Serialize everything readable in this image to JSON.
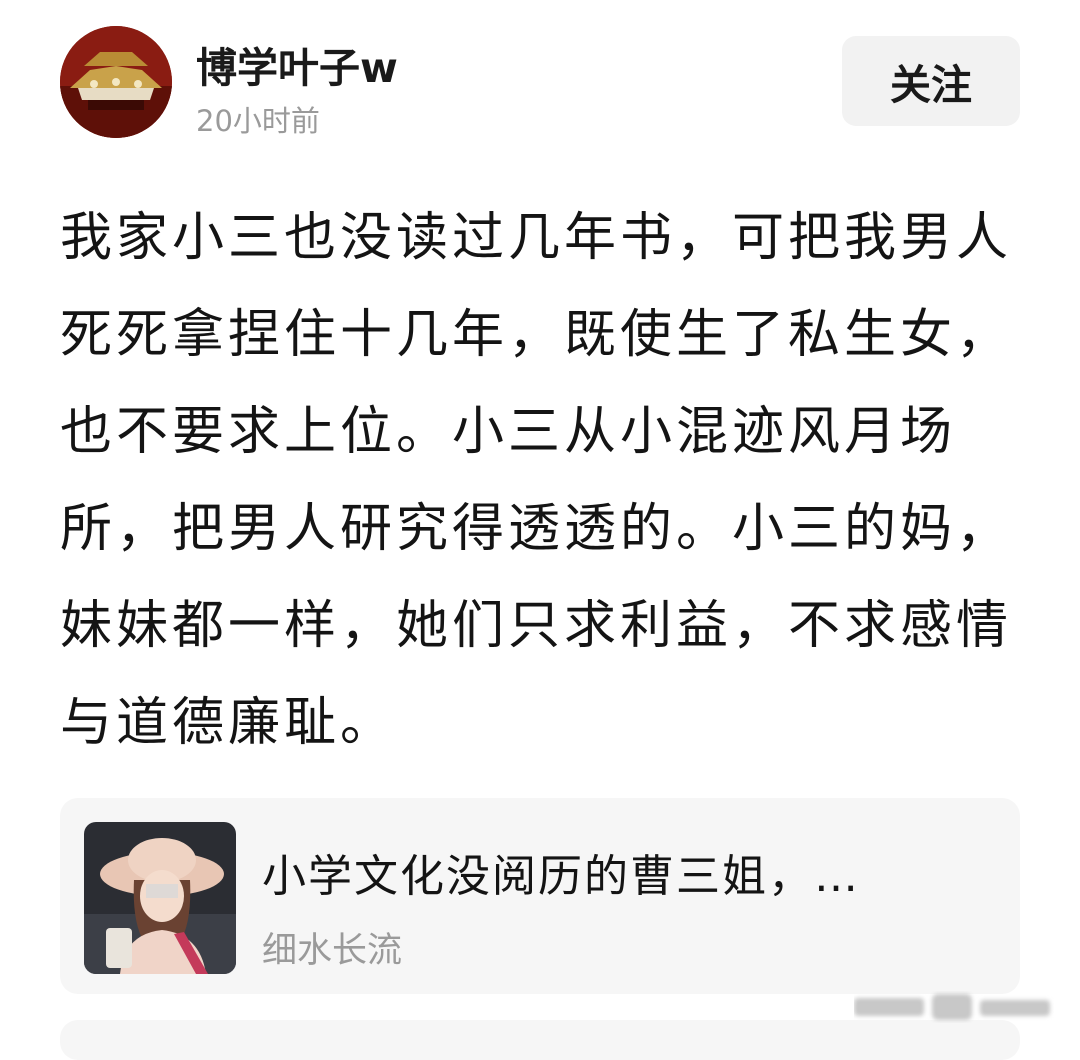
{
  "header": {
    "author": "博学叶子w",
    "time": "20小时前",
    "follow_label": "关注"
  },
  "post": {
    "text": "我家小三也没读过几年书，可把我男人死死拿捏住十几年，既使生了私生女，也不要求上位。小三从小混迹风月场所，把男人研究得透透的。小三的妈，妹妹都一样，她们只求利益，不求感情与道德廉耻。"
  },
  "linked_card": {
    "title": "小学文化没阅历的曹三姐，…",
    "source": "细水长流"
  },
  "icons": {
    "avatar": "palace-roof-avatar",
    "thumbnail": "woman-in-sun-hat-photo",
    "watermark": "blurred-watermark"
  },
  "colors": {
    "background": "#ffffff",
    "card": "#f6f6f6",
    "follow_button": "#f2f2f2",
    "muted_text": "#9a9a9a"
  }
}
